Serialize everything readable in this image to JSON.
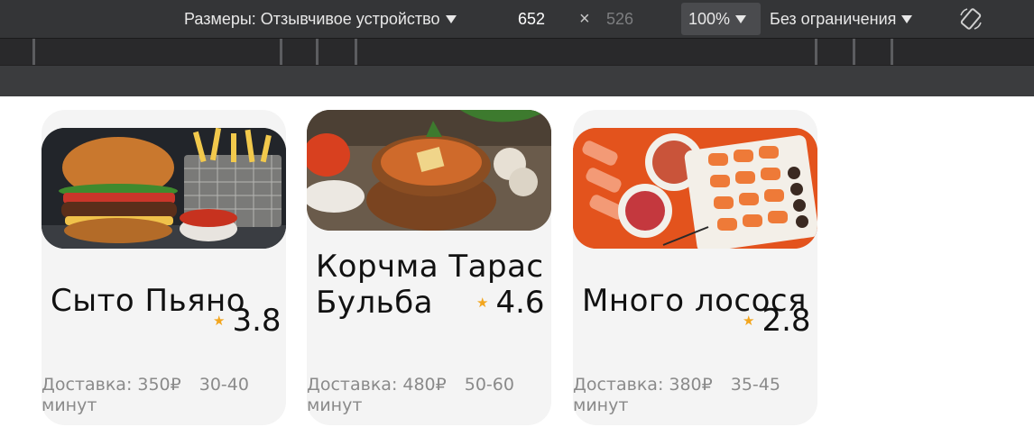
{
  "toolbar": {
    "dimensions_label": "Размеры: Отзывчивое устройство",
    "width_value": "652",
    "separator": "×",
    "height_value": "526",
    "zoom": "100%",
    "throttle": "Без ограничения",
    "rotate_icon": "rotate-device-icon"
  },
  "colors": {
    "toolbar_bg": "#343537",
    "card_bg": "#f4f4f4",
    "star": "#f2a51d"
  },
  "restaurants": [
    {
      "name": "Сыто Пьяно",
      "rating": "3.8",
      "delivery": "Доставка: 350₽",
      "time": "30-40 минут",
      "photo": "burger-photo"
    },
    {
      "name": "Корчма Тарас Бульба",
      "rating": "4.6",
      "delivery": "Доставка: 480₽",
      "time": "50-60 минут",
      "photo": "soup-photo"
    },
    {
      "name": "Много лосося",
      "rating": "2.8",
      "delivery": "Доставка: 380₽",
      "time": "35-45 минут",
      "photo": "sushi-photo"
    }
  ]
}
